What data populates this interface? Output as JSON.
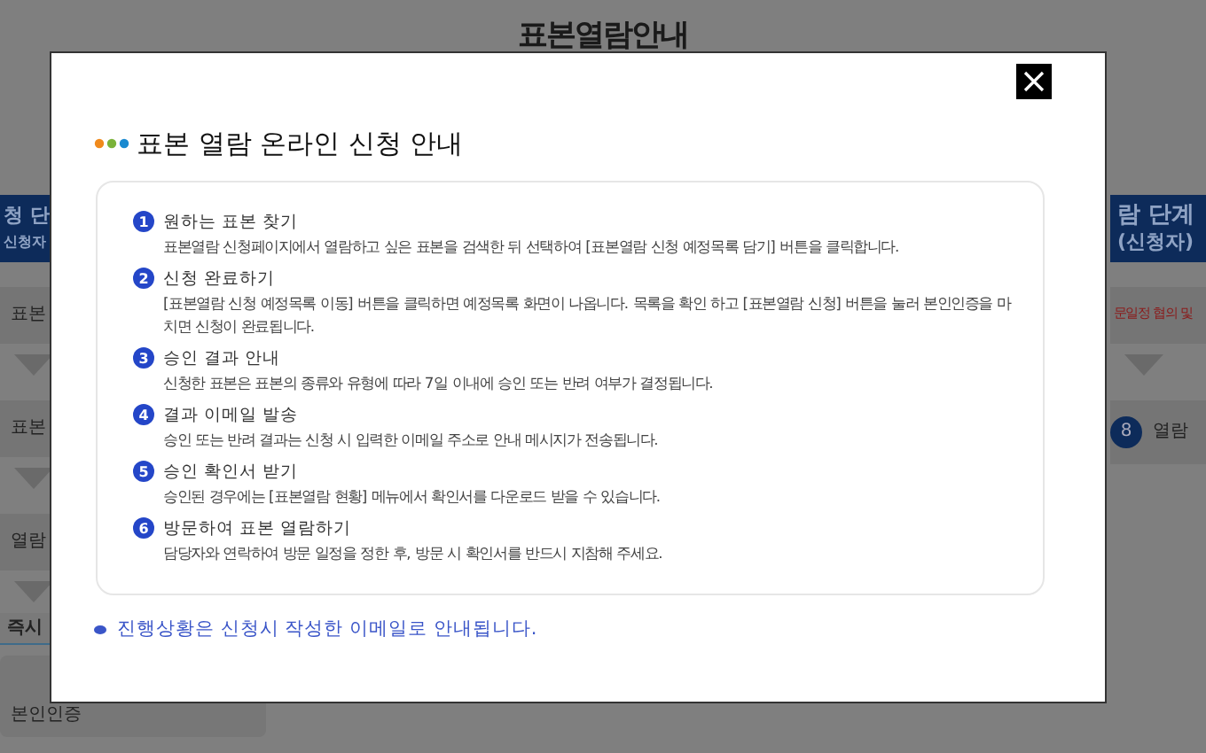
{
  "page": {
    "title": "표본열람안내"
  },
  "left_panel": {
    "header": [
      "청 단",
      "신청자"
    ],
    "items": [
      {
        "kind": "step",
        "label": "표본"
      },
      {
        "kind": "step",
        "label": "표본"
      },
      {
        "kind": "step",
        "label": "열람"
      }
    ],
    "tag": "즉시",
    "box": "본인인증"
  },
  "right_panel": {
    "header": [
      "람 단계",
      "(신청자)"
    ],
    "items": [
      {
        "kind": "note",
        "label": "문일정 협의 및"
      },
      {
        "kind": "numbered",
        "number": "8",
        "label": "열람"
      }
    ]
  },
  "modal": {
    "title": "표본 열람 온라인 신청 안내",
    "steps": [
      {
        "number": "1",
        "title": "원하는 표본 찾기",
        "text": "표본열람 신청페이지에서 열람하고 싶은 표본을 검색한 뒤 선택하여 [표본열람 신청 예정목록 담기] 버튼을 클릭합니다."
      },
      {
        "number": "2",
        "title": "신청 완료하기",
        "text": "[표본열람 신청 예정목록 이동] 버튼을 클릭하면 예정목록 화면이 나옵니다. 목록을 확인 하고 [표본열람 신청] 버튼을 눌러 본인인증을 마치면 신청이 완료됩니다."
      },
      {
        "number": "3",
        "title": "승인 결과 안내",
        "text": "신청한 표본은 표본의 종류와 유형에 따라 7일 이내에 승인 또는 반려 여부가 결정됩니다."
      },
      {
        "number": "4",
        "title": "결과 이메일 발송",
        "text": "승인 또는 반려 결과는 신청 시 입력한 이메일 주소로 안내 메시지가 전송됩니다."
      },
      {
        "number": "5",
        "title": "승인 확인서 받기",
        "text": "승인된 경우에는 [표본열람 현황] 메뉴에서 확인서를 다운로드 받을 수 있습니다."
      },
      {
        "number": "6",
        "title": "방문하여 표본 열람하기",
        "text": "담당자와 연락하여 방문 일정을 정한 후, 방문 시 확인서를 반드시 지참해 주세요."
      }
    ],
    "note": "진행상황은 신청시 작성한 이메일로 안내됩니다."
  }
}
